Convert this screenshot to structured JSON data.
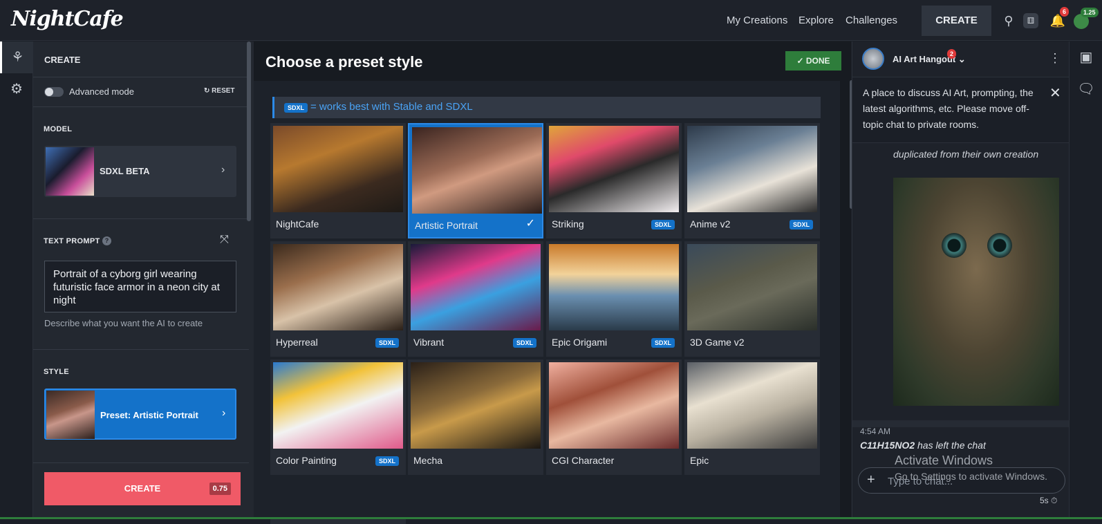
{
  "brand": {
    "logo": "NightCafe"
  },
  "nav": {
    "my_creations": "My Creations",
    "explore": "Explore",
    "challenges": "Challenges",
    "create": "CREATE",
    "notif_count": "6",
    "credits": "1.25"
  },
  "panel": {
    "header": "CREATE",
    "advanced_mode": "Advanced mode",
    "reset": "RESET",
    "model_label": "MODEL",
    "model_name": "SDXL BETA",
    "prompt_label": "TEXT PROMPT",
    "prompt_help_icon": "?",
    "prompt_value": "Portrait of a cyborg girl wearing futuristic face armor in a neon city at night",
    "prompt_help": "Describe what you want the AI to create",
    "style_label": "STYLE",
    "style_name": "Preset: Artistic Portrait",
    "create_button": "CREATE",
    "create_cost": "0.75"
  },
  "main": {
    "title": "Choose a preset style",
    "done": "DONE",
    "banner_tag": "SDXL",
    "banner_text": "= works best with Stable and SDXL",
    "styles": [
      {
        "name": "NightCafe",
        "tag": "",
        "selected": false
      },
      {
        "name": "Artistic Portrait",
        "tag": "",
        "selected": true
      },
      {
        "name": "Striking",
        "tag": "SDXL",
        "selected": false
      },
      {
        "name": "Anime v2",
        "tag": "SDXL",
        "selected": false
      },
      {
        "name": "Hyperreal",
        "tag": "SDXL",
        "selected": false
      },
      {
        "name": "Vibrant",
        "tag": "SDXL",
        "selected": false
      },
      {
        "name": "Epic Origami",
        "tag": "SDXL",
        "selected": false
      },
      {
        "name": "3D Game v2",
        "tag": "",
        "selected": false
      },
      {
        "name": "Color Painting",
        "tag": "SDXL",
        "selected": false
      },
      {
        "name": "Mecha",
        "tag": "",
        "selected": false
      },
      {
        "name": "CGI Character",
        "tag": "",
        "selected": false
      },
      {
        "name": "Epic",
        "tag": "",
        "selected": false
      }
    ]
  },
  "chat": {
    "room_name": "AI Art Hangout",
    "room_badge": "2",
    "info": "A place to discuss AI Art, prompting, the latest algorithms, etc. Please move off-topic chat to private rooms.",
    "prev_message_tail": "duplicated from their own creation",
    "msg_time": "4:54 AM",
    "msg_user": "C11H15NO2",
    "msg_text": " has left the chat",
    "input_placeholder": "Type to chat...",
    "slow_mode": "5s"
  },
  "watermark": {
    "line1": "Activate Windows",
    "line2": "Go to Settings to activate Windows."
  },
  "colors": {
    "accent_blue": "#1472c9",
    "create_red": "#f05a67",
    "done_green": "#2e7d3b"
  }
}
